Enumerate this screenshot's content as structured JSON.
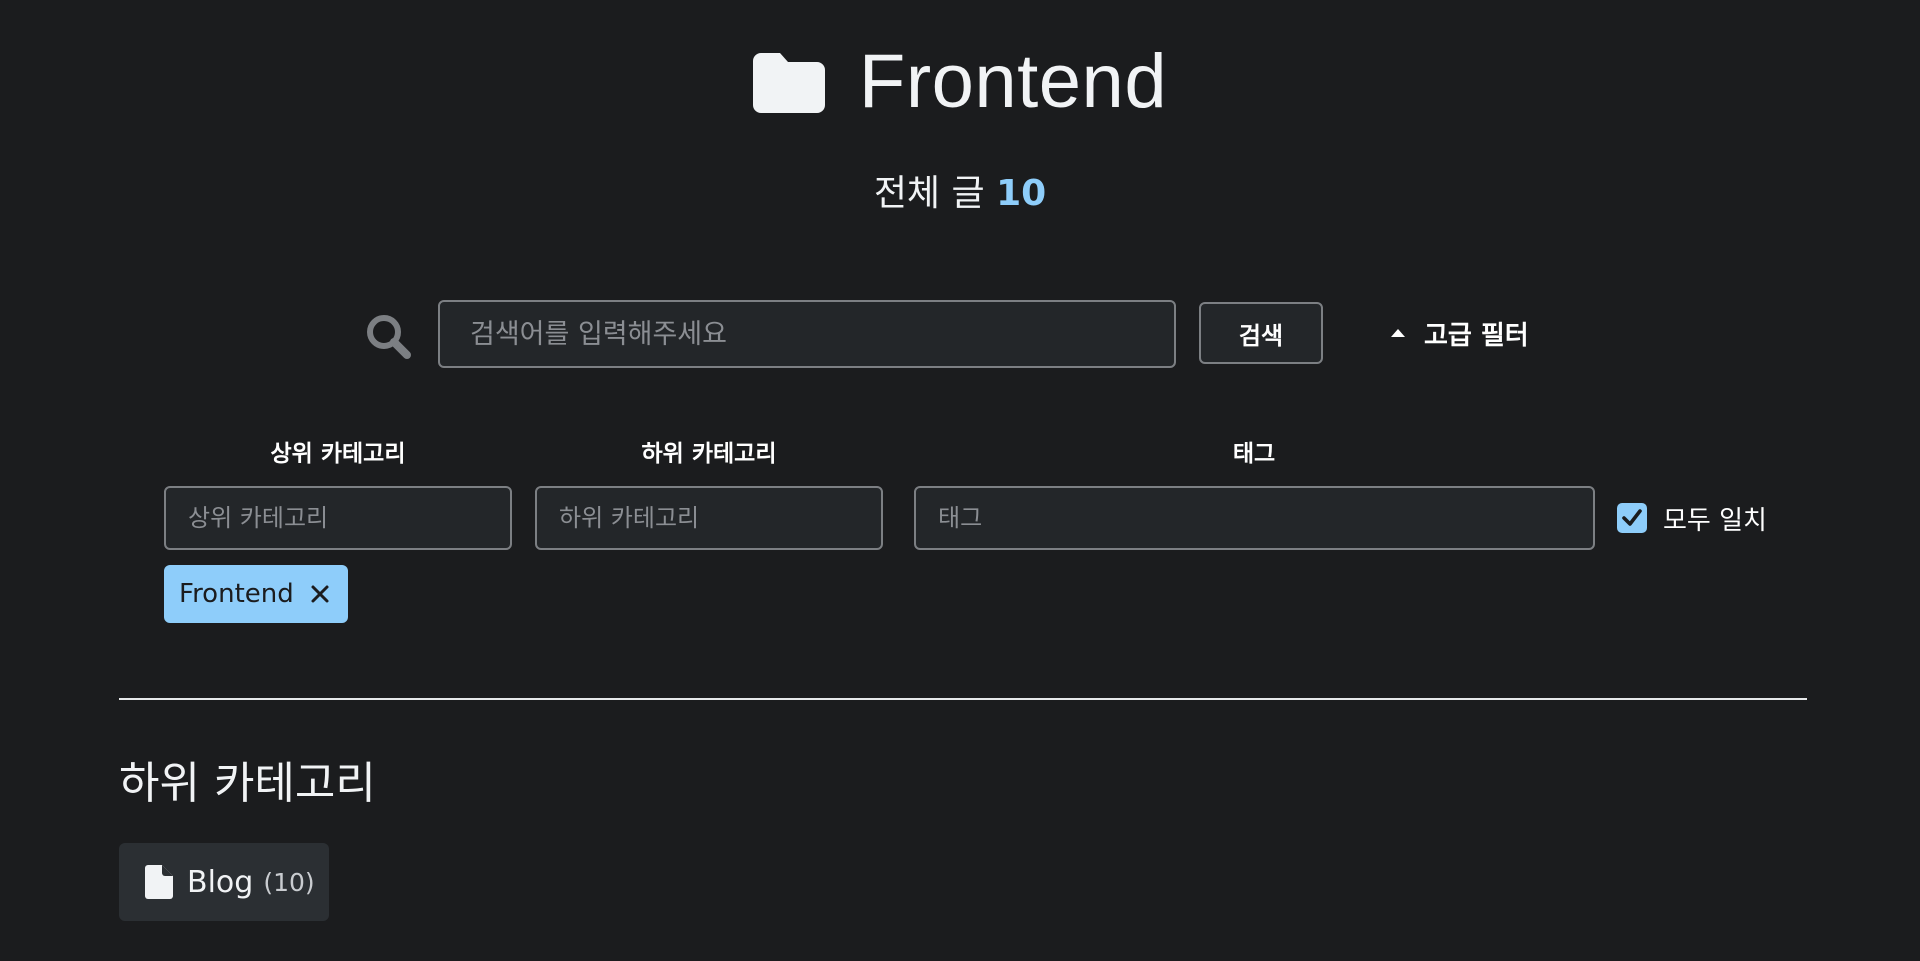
{
  "header": {
    "title": "Frontend",
    "title_icon": "folder-icon",
    "count_label": "전체 글",
    "count_value": "10"
  },
  "search": {
    "icon": "search-icon",
    "placeholder": "검색어를 입력해주세요",
    "value": "",
    "button_label": "검색",
    "advanced_filter_label": "고급 필터",
    "advanced_filter_icon": "caret-up-icon"
  },
  "filters": {
    "parent_category_label": "상위 카테고리",
    "parent_category_placeholder": "상위 카테고리",
    "sub_category_label": "하위 카테고리",
    "sub_category_placeholder": "하위 카테고리",
    "tag_label": "태그",
    "tag_placeholder": "태그",
    "match_all_label": "모두 일치",
    "match_all_checked": true,
    "active_chips": [
      {
        "label": "Frontend"
      }
    ]
  },
  "subcategories": {
    "title": "하위 카테고리",
    "items": [
      {
        "name": "Blog",
        "count": "(10)",
        "icon": "file-icon"
      }
    ]
  },
  "colors": {
    "background": "#1b1c1e",
    "accent": "#8ecdfa",
    "input_background": "#232629",
    "card_background": "#2b2f33"
  }
}
